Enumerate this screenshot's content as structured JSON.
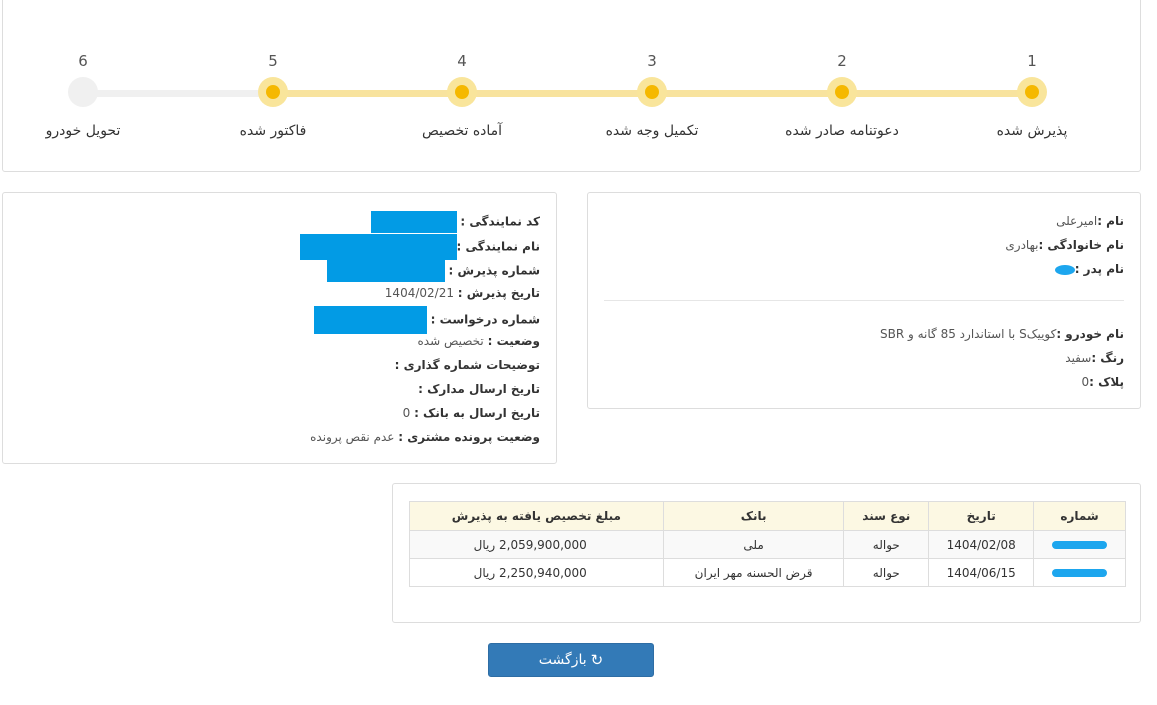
{
  "steps": [
    {
      "num": "1",
      "label": "پذیرش شده"
    },
    {
      "num": "2",
      "label": "دعوتنامه صادر شده"
    },
    {
      "num": "3",
      "label": "تکمیل وجه شده"
    },
    {
      "num": "4",
      "label": "آماده تخصیص"
    },
    {
      "num": "5",
      "label": "فاکتور شده"
    },
    {
      "num": "6",
      "label": "تحویل خودرو"
    }
  ],
  "completed_steps": 5,
  "customer": {
    "name_label": "نام :",
    "name_value": "امیرعلی",
    "family_label": "نام خانوادگی :",
    "family_value": "بهادری",
    "father_label": "نام پدر :"
  },
  "vehicle": {
    "model_label": "نام خودرو :",
    "model_value": "کوییکS با استاندارد 85 گانه و SBR",
    "color_label": "رنگ :",
    "color_value": "سفید",
    "plate_label": "پلاک :",
    "plate_value": "0"
  },
  "agency": {
    "code_label": "کد نمایندگی :",
    "name_label": "نام نمایندگی :",
    "reception_no_label": "شماره پذیرش :",
    "reception_date_label": "تاریخ پذیرش :",
    "reception_date_value": "1404/02/21",
    "request_no_label": "شماره درخواست :",
    "status_label": "وضعیت :",
    "status_value": "تخصیص شده",
    "numbering_desc_label": "توضیحات شماره گذاری :",
    "docs_sent_label": "تاریخ ارسال مدارک :",
    "bank_sent_label": "تاریخ ارسال به بانک :",
    "bank_sent_value": "0",
    "file_status_label": "وضعیت پرونده مشتری :",
    "file_status_value": "عدم نقص پرونده"
  },
  "payments": {
    "headers": [
      "شماره",
      "تاریخ",
      "نوع سند",
      "بانک",
      "مبلغ تخصیص یافته به پذیرش"
    ],
    "rows": [
      {
        "date": "1404/02/08",
        "doc_type": "حواله",
        "bank": "ملی",
        "amount": "2,059,900,000 ریال"
      },
      {
        "date": "1404/06/15",
        "doc_type": "حواله",
        "bank": "قرض الحسنه مهر ایران",
        "amount": "2,250,940,000 ریال"
      }
    ]
  },
  "back_button": "بازگشت",
  "colors": {
    "accent": "#f5b800",
    "accent_light": "#f9e59b",
    "primary": "#337ab7",
    "redaction": "#029be5"
  }
}
